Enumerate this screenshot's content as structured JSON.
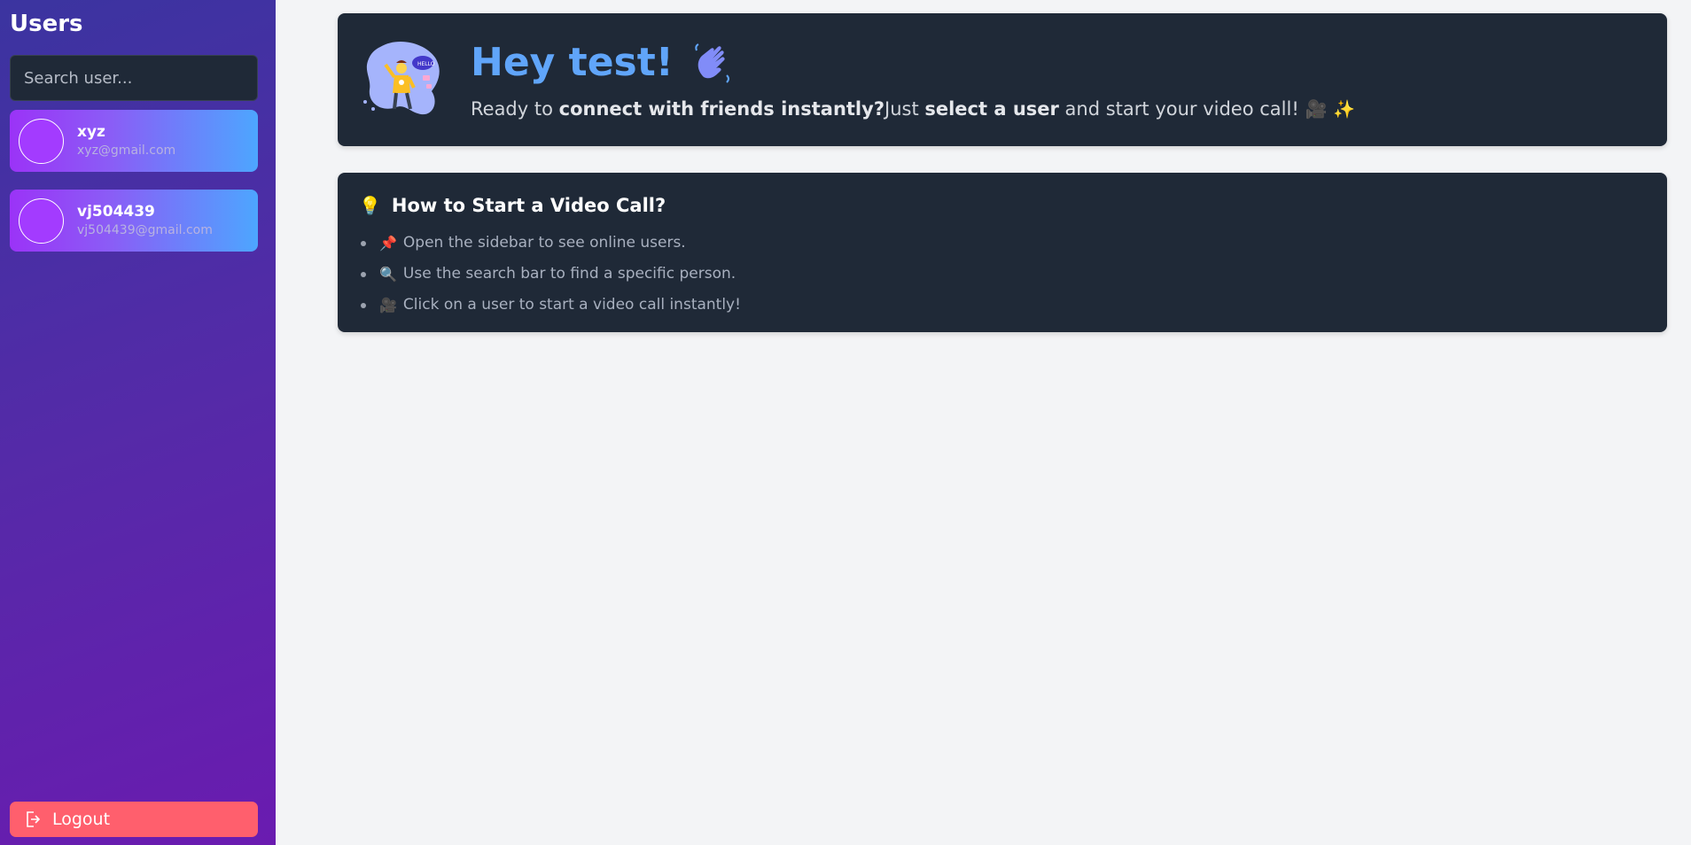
{
  "sidebar": {
    "title": "Users",
    "search": {
      "placeholder": "Search user...",
      "value": ""
    },
    "users": [
      {
        "name": "xyz",
        "email": "xyz@gmail.com"
      },
      {
        "name": "vj504439",
        "email": "vj504439@gmail.com"
      }
    ],
    "logout_label": "Logout"
  },
  "welcome": {
    "title": "Hey test!",
    "text_1": "Ready to ",
    "text_bold_1": "connect with friends instantly?",
    "text_2": "Just ",
    "text_bold_2": "select a user",
    "text_3": " and start your video call! ",
    "emoji_camera": "🎥",
    "emoji_sparkles": "✨"
  },
  "help": {
    "icon": "💡",
    "title": "How to Start a Video Call?",
    "items": [
      {
        "emoji": "📌",
        "text": "Open the sidebar to see online users."
      },
      {
        "emoji": "🔍",
        "text": "Use the search bar to find a specific person."
      },
      {
        "emoji": "🎥",
        "text": "Click on a user to start a video call instantly!"
      }
    ]
  },
  "colors": {
    "sidebar_gradient_start": "#3b34a0",
    "sidebar_gradient_end": "#6a1bb0",
    "card_bg": "#1f2937",
    "title_blue": "#60a5fa",
    "logout_red": "#ff5f6d",
    "page_bg": "#f3f4f6"
  },
  "icons": {
    "illustration": "hello-illustration-icon",
    "wave": "waving-hand-icon",
    "logout": "logout-icon"
  }
}
